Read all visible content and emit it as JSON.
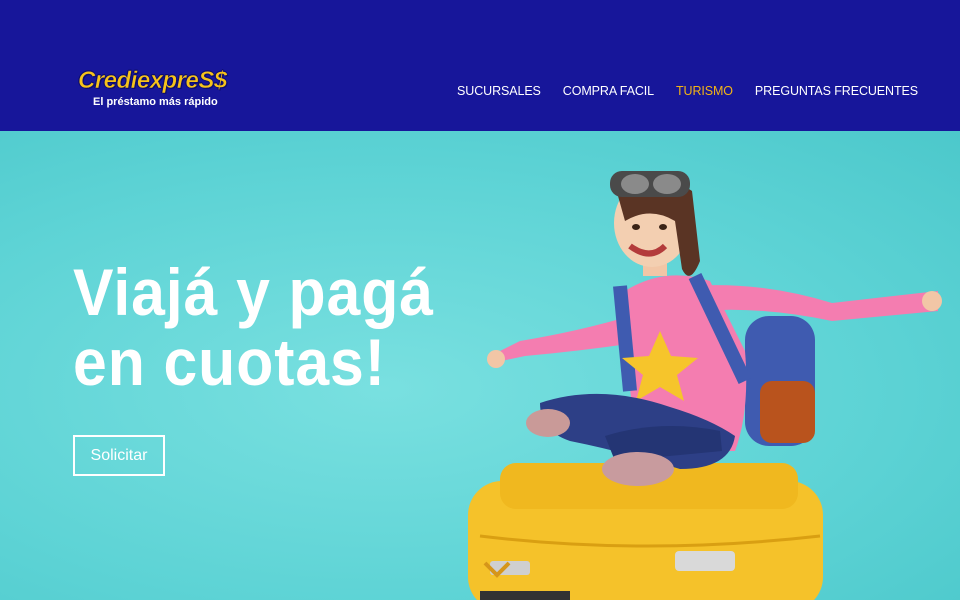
{
  "brand": {
    "name": "CrediexpreS$",
    "tagline": "El préstamo más rápido",
    "colors": {
      "header": "#17169a",
      "accent": "#f2b316",
      "hero_bg": "#62d4d6"
    }
  },
  "nav": {
    "items": [
      {
        "label": "SUCURSALES",
        "active": false
      },
      {
        "label": "COMPRA FACIL",
        "active": false
      },
      {
        "label": "TURISMO",
        "active": true
      },
      {
        "label": "PREGUNTAS FRECUENTES",
        "active": false
      }
    ]
  },
  "hero": {
    "headline_line1": "Viajá y pagá",
    "headline_line2": "en cuotas!",
    "cta_label": "Solicitar",
    "image_subject": "girl-with-aviator-goggles-on-yellow-suitcase"
  }
}
